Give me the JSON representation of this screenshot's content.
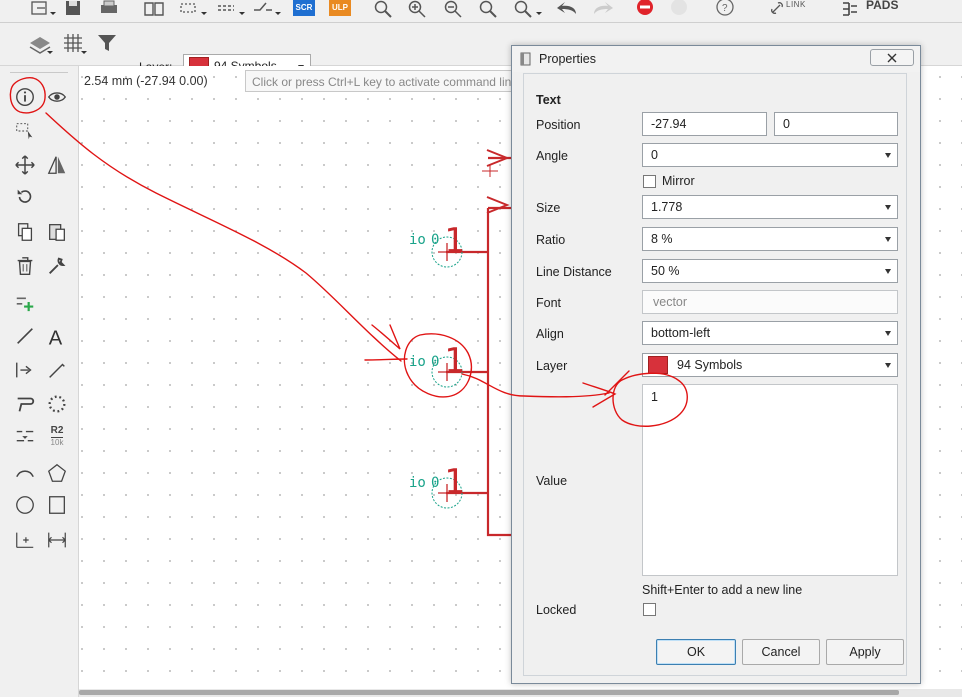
{
  "colors": {
    "annotation": "#e01414",
    "symbol_green": "#1aa38a",
    "net_red": "#c8282b",
    "layer_swatch": "#d7313b"
  },
  "toolbar": {
    "link_label": "LINK",
    "pads_label": "PADS",
    "scr_badge": "SCR",
    "ulp_badge": "ULP"
  },
  "layer_bar": {
    "label": "Layer:",
    "selected": "94 Symbols"
  },
  "status": {
    "coordinates": "2.54 mm (-27.94 0.00)",
    "command_placeholder": "Click or press Ctrl+L key to activate command line"
  },
  "canvas": {
    "pins": [
      {
        "name": "io",
        "pad": "0",
        "value": "1"
      },
      {
        "name": "io",
        "pad": "0",
        "value": "1"
      },
      {
        "name": "io",
        "pad": "0",
        "value": "1"
      }
    ]
  },
  "left_tools": [
    "info-icon",
    "eye-icon",
    "select-icon",
    "move-icon",
    "mirror-icon",
    "rotate-icon",
    "copy-icon",
    "paste-icon",
    "delete-icon",
    "wrench-icon",
    "add-part-icon",
    "line-icon",
    "text-icon",
    "pin-icon",
    "wire-icon",
    "split-icon",
    "group-icon",
    "swap-icon",
    "value-icon",
    "arc-icon",
    "polygon-icon",
    "circle-icon",
    "rectangle-icon",
    "mark-icon",
    "dimension-icon"
  ],
  "value_tool_labels": {
    "top": "R2",
    "bottom": "10k"
  },
  "dialog": {
    "title": "Properties",
    "section": "Text",
    "position": {
      "label": "Position",
      "x": "-27.94",
      "y": "0"
    },
    "angle": {
      "label": "Angle",
      "value": "0"
    },
    "mirror": {
      "label": "Mirror",
      "checked": false
    },
    "size": {
      "label": "Size",
      "value": "1.778"
    },
    "ratio": {
      "label": "Ratio",
      "value": "8 %"
    },
    "line_distance": {
      "label": "Line Distance",
      "value": "50 %"
    },
    "font": {
      "label": "Font",
      "value": "vector"
    },
    "align": {
      "label": "Align",
      "value": "bottom-left"
    },
    "layer": {
      "label": "Layer",
      "value": "94 Symbols"
    },
    "value": {
      "label": "Value",
      "text": "1",
      "hint": "Shift+Enter to add a new line"
    },
    "locked": {
      "label": "Locked",
      "checked": false
    },
    "buttons": {
      "ok": "OK",
      "cancel": "Cancel",
      "apply": "Apply"
    }
  }
}
